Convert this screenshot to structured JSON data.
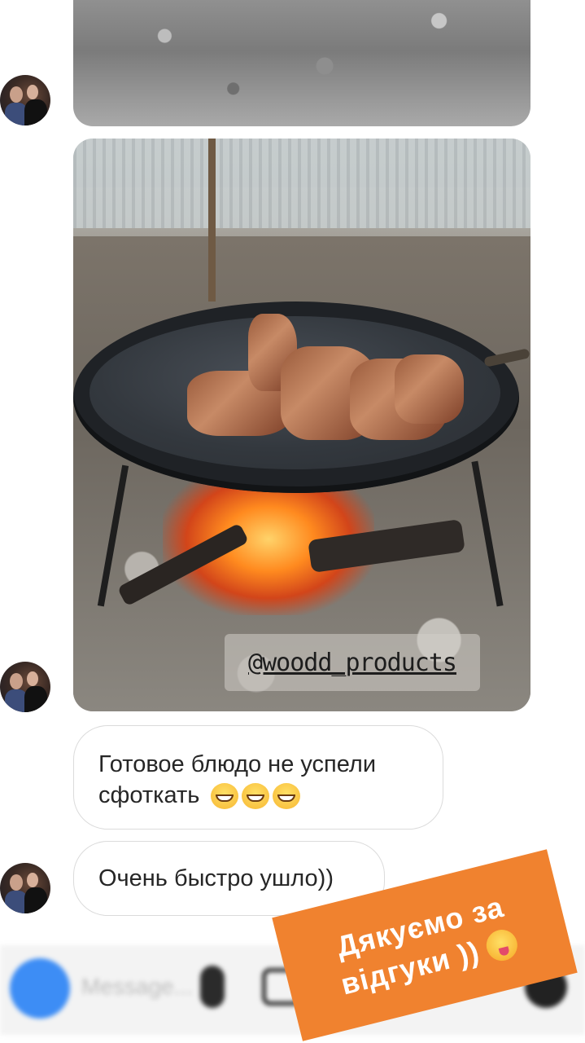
{
  "thread": {
    "messages": [
      {
        "type": "photo",
        "sender": "contact",
        "description": "top cropped photo"
      },
      {
        "type": "photo",
        "sender": "contact",
        "watermark": "@woodd_products"
      },
      {
        "type": "text",
        "sender": "contact",
        "text": "Готовое блюдо не успели сфоткать",
        "emoji": [
          "grinning-tears",
          "grinning-tears",
          "grinning-tears"
        ]
      },
      {
        "type": "text",
        "sender": "contact",
        "text": "Очень быстро ушло))"
      }
    ]
  },
  "composer": {
    "placeholder": "Message...",
    "accent_color": "#3d8df5"
  },
  "overlay_sticker": {
    "line1": "Дякуємо за",
    "line2": "відгуки ))",
    "emoji": "yum",
    "background": "#f0822f"
  }
}
